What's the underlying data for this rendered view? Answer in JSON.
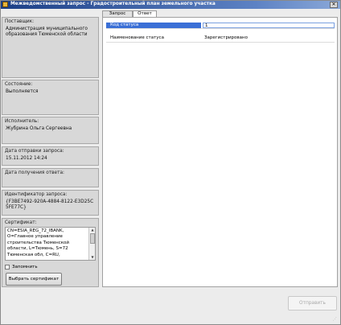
{
  "window": {
    "title": "Межведомственный запрос - Градостроительный план земельного участка",
    "close_glyph": "✕",
    "title_icon": "app-icon"
  },
  "left_panel": {
    "supplier": {
      "label": "Поставщик:",
      "value": "Администрация муниципального образования Тюменской области"
    },
    "state": {
      "label": "Состояние:",
      "value": "Выполняется"
    },
    "executor": {
      "label": "Исполнитель:",
      "value": "Жубрина Ольга Сергеевна"
    },
    "sent_date": {
      "label": "Дата отправки запроса:",
      "value": "15.11.2012 14:24"
    },
    "received_date": {
      "label": "Дата получения ответа:",
      "value": ""
    },
    "request_id": {
      "label": "Идентификатор запроса:",
      "value": "{F3BE7492-920A-4884-8122-E3D25C5FE77C}"
    },
    "certificate": {
      "label": "Сертификат:",
      "value": "CN=ESIA_REG_72_IBANK, O=Главное управление строительства Тюменской области, L=Тюмень, S=72 Тюменская обл, C=RU,",
      "remember_label": "Запомнить",
      "remember_checked": false,
      "choose_button": "Выбрать сертификат"
    }
  },
  "tabs": [
    {
      "label": "Запрос",
      "active": false
    },
    {
      "label": "Ответ",
      "active": true
    }
  ],
  "response_grid": [
    {
      "key": "Код статуса",
      "value": "1",
      "selected": true
    },
    {
      "key": "Наименование статуса",
      "value": "Зарегистрировано",
      "selected": false
    }
  ],
  "footer": {
    "send_button": "Отправить",
    "send_enabled": false
  },
  "colors": {
    "titlebar": "#1c3f86",
    "selection": "#3a6fd6",
    "panel": "#d8d8d8"
  }
}
